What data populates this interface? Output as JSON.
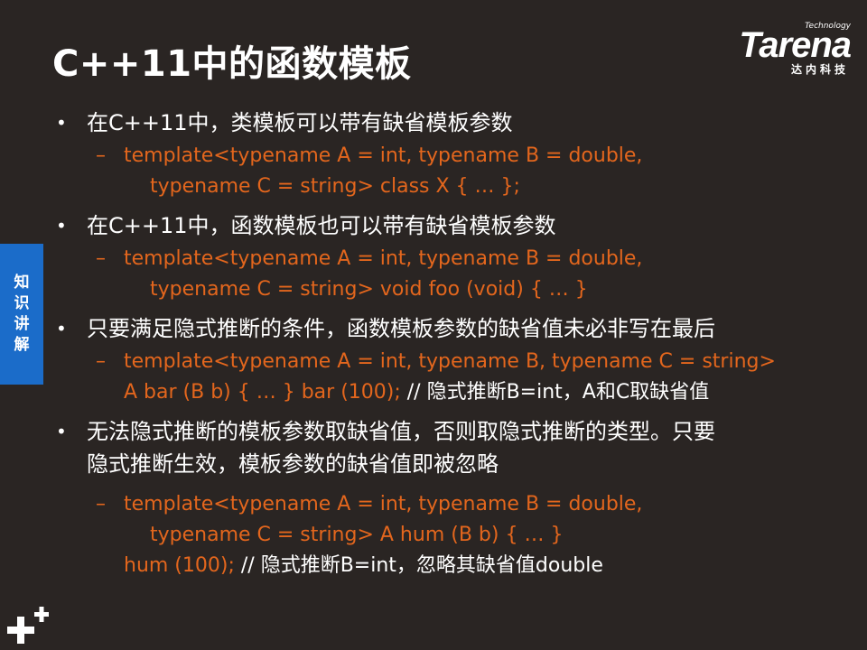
{
  "slide": {
    "title": "C++11中的函数模板",
    "logo": {
      "small": "Technology",
      "main": "Tarena",
      "cn": "达内科技"
    },
    "side_tab": [
      "知",
      "识",
      "讲",
      "解"
    ],
    "bullets": [
      {
        "text": "在C++11中，类模板可以带有缺省模板参数",
        "sub": {
          "line1": "template<typename A = int, typename B = double,",
          "line2": "typename C = string> class X { … };"
        }
      },
      {
        "text": "在C++11中，函数模板也可以带有缺省模板参数",
        "sub": {
          "line1": "template<typename A = int, typename B = double,",
          "line2": "typename C = string> void foo (void) { … }"
        }
      },
      {
        "text": "只要满足隐式推断的条件，函数模板参数的缺省值未必非写在最后",
        "sub": {
          "line1": "template<typename A = int, typename B, typename C = string>",
          "line2_code": "A bar (B b) { … } bar (100);",
          "line2_comment": " // 隐式推断B=int，A和C取缺省值"
        }
      },
      {
        "text_line1": "无法隐式推断的模板参数取缺省值，否则取隐式推断的类型。只要",
        "text_line2": "隐式推断生效，模板参数的缺省值即被忽略",
        "sub": {
          "line1": "template<typename A = int, typename B = double,",
          "line2": "typename C = string> A hum (B b) { … }",
          "line3_code": "hum (100);",
          "line3_comment": " // 隐式推断B=int，忽略其缺省值double"
        }
      }
    ],
    "bullet_glyph": "•",
    "dash_glyph": "–"
  },
  "colors": {
    "background": "#2a2523",
    "code": "#e3661d",
    "side_tab": "#1b6cc9",
    "text": "#ffffff"
  }
}
